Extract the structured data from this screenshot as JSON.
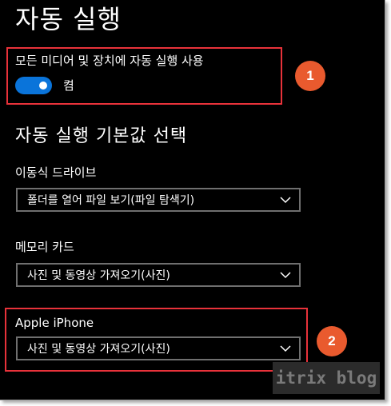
{
  "page": {
    "title": "자동 실행"
  },
  "autoplay": {
    "label": "모든 미디어 및 장치에 자동 실행 사용",
    "toggle_state": "켬",
    "toggle_on": true,
    "accent_color": "#0a74da"
  },
  "defaults": {
    "title": "자동 실행 기본값 선택",
    "removable_drive": {
      "label": "이동식 드라이브",
      "value": "폴더를 열어 파일 보기(파일 탐색기)"
    },
    "memory_card": {
      "label": "메모리 카드",
      "value": "사진 및 동영상 가져오기(사진)"
    },
    "iphone": {
      "label": "Apple iPhone",
      "value": "사진 및 동영상 가져오기(사진)"
    }
  },
  "annotations": {
    "badge_1": "1",
    "badge_2": "2",
    "highlight_color": "#e8323a",
    "badge_color": "#e95a2e"
  },
  "watermark": {
    "text": "itrix blog"
  }
}
